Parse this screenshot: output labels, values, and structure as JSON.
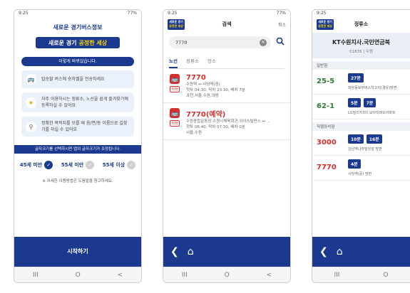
{
  "colors": {
    "primary": "#1b3a8f",
    "accent": "#ffd400",
    "route_red": "#d32f2f",
    "route_green": "#2e7d32"
  },
  "status_bar": {
    "time": "9:25",
    "battery": "77%"
  },
  "nav_bar": {
    "recent": "III",
    "home": "O",
    "back": "<"
  },
  "logo": {
    "line1": "새로운 경기",
    "line2": "공정한 세상"
  },
  "screen1": {
    "subtitle": "새로운 경기버스정보",
    "banner_left": "새로운 경기",
    "banner_right": "공정한 세상",
    "changes_pill": "이렇게 바뀌었습니다.",
    "features": [
      {
        "icon": "bus-transfer-icon",
        "text": "탑승할 버스에 승차벨을 전송하세요"
      },
      {
        "icon": "star-icon",
        "text": "자주 이용하시는 정류소, 노선을 쉽게 즐겨찾기에 등록하실 수 있어요"
      },
      {
        "icon": "search-icon",
        "text": "정확한 목적지를 모를 때 음/면/동 이름으로 길찾기를 하실 수 있어요"
      }
    ],
    "font_note": "글자크기를 선택하시면 앱의 글자크기가 조정됩니다.",
    "age_options": [
      {
        "label": "45세 미만",
        "selected": true
      },
      {
        "label": "55세 미만",
        "selected": false
      },
      {
        "label": "55세 이상",
        "selected": false
      }
    ],
    "help_note": "※ 자세한 이용방법은 도움말을 참고하세요.",
    "start_button": "시작하기"
  },
  "screen2": {
    "title": "검색",
    "cancel": "취소",
    "search_value": "7770",
    "tabs": [
      "노선",
      "정류소",
      "장소"
    ],
    "active_tab": 0,
    "results": [
      {
        "number": "7770",
        "type": "직좌",
        "lines": [
          "수원역 ↔ 사당역(중)",
          "첫차 04:30, 막차 23:30, 배차 7분",
          "과천,서울,수원,의왕"
        ]
      },
      {
        "number": "7770(예약)",
        "type": "직좌",
        "lines": [
          "수원종합운동장.수원시체육회관.아이스빌펀스 ↔ ...",
          "첫차 06:40, 막차 07:30, 배차 0분",
          "서울,수원"
        ]
      }
    ]
  },
  "screen3": {
    "title": "정류소",
    "stop_name": "KT수원지사.국민연금북",
    "stop_id": "01835 | 수원",
    "sections": [
      {
        "label": "일반형",
        "color": "#2e7d32",
        "routes": [
          {
            "number": "25-5",
            "badges": [
              "27분"
            ],
            "destination": "파장동북부버스차고지(경유)방면"
          },
          {
            "number": "62-1",
            "badges": [
              "5분",
              "7분"
            ],
            "destination": "LG빌리지3차.모아미래도아파트"
          }
        ]
      },
      {
        "label": "직행좌석형",
        "color": "#d32f2f",
        "routes": [
          {
            "number": "3000",
            "badges": [
              "10분",
              "16분"
            ],
            "destination": "강남역나라빌딩앞 방면"
          },
          {
            "number": "7770",
            "badges": [
              "4분"
            ],
            "destination": "사당역(중) 방면"
          }
        ]
      }
    ]
  }
}
